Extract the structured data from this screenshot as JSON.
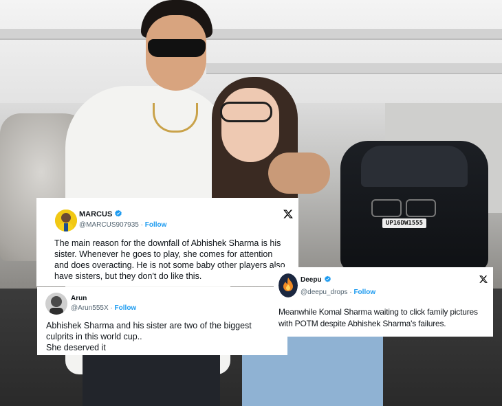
{
  "photo": {
    "car_plate": "UP16DW1555"
  },
  "tweets": [
    {
      "name": "MARCUS",
      "handle": "@MARCUS907935",
      "separator": "·",
      "follow": "Follow",
      "verified": true,
      "text": "The main reason for the downfall of Abhishek Sharma is his sister. Whenever he goes to play, she comes for attention and does overacting. He is not some baby other players also have sisters, but they don't do like this."
    },
    {
      "name": "Arun",
      "handle": "@Arun555X",
      "separator": "·",
      "follow": "Follow",
      "verified": false,
      "text_lines": [
        "Abhishek Sharma and his sister  are two of the biggest",
        "culprits in this world cup..",
        "She deserved it"
      ]
    },
    {
      "name": "Deepu",
      "handle": "@deepu_drops",
      "separator": "·",
      "follow": "Follow",
      "verified": true,
      "text": "Meanwhile Komal Sharma waiting to click family pictures with POTM despite Abhishek Sharma's failures."
    }
  ],
  "colors": {
    "verified": "#1d9bf0",
    "follow": "#1d9bf0",
    "handle": "#536471",
    "text": "#0f1419"
  },
  "icons": {
    "platform": "x-logo-icon",
    "verified": "verified-badge-icon"
  }
}
